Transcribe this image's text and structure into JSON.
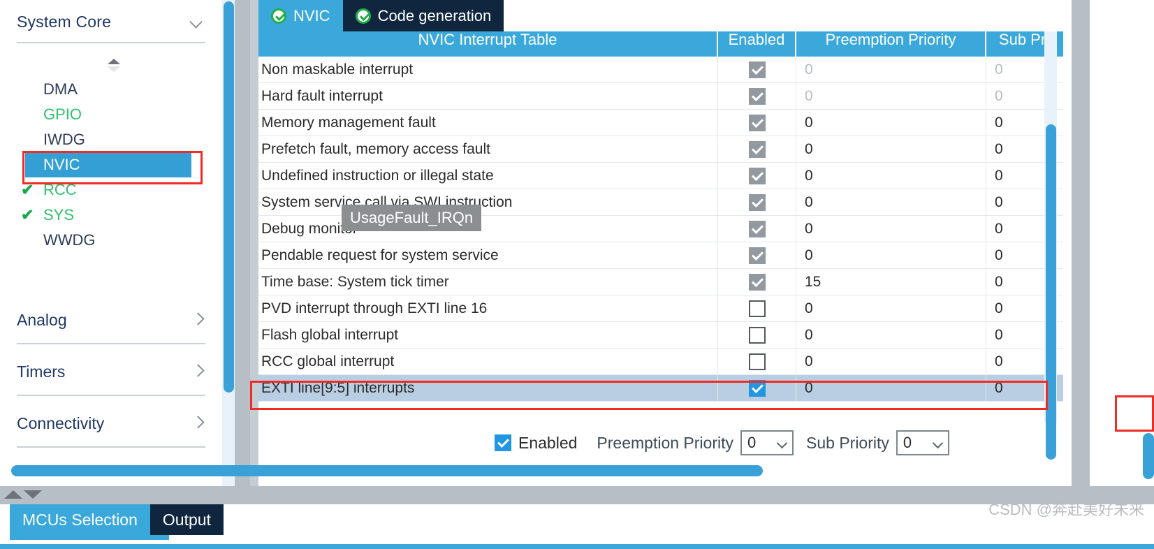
{
  "sidebar": {
    "header": {
      "title": "System Core",
      "chevron": "chevron-down-icon"
    },
    "sorter_icon": "sort-updown-icon",
    "items": [
      {
        "label": "DMA",
        "state": "normal",
        "check": ""
      },
      {
        "label": "GPIO",
        "state": "configured",
        "check": ""
      },
      {
        "label": "IWDG",
        "state": "normal",
        "check": ""
      },
      {
        "label": "NVIC",
        "state": "selected",
        "check": ""
      },
      {
        "label": "RCC",
        "state": "configured",
        "check": "✔"
      },
      {
        "label": "SYS",
        "state": "configured",
        "check": "✔"
      },
      {
        "label": "WWDG",
        "state": "normal",
        "check": ""
      }
    ],
    "groups": [
      {
        "label": "Analog",
        "chevron": "chevron-right-icon"
      },
      {
        "label": "Timers",
        "chevron": "chevron-right-icon"
      },
      {
        "label": "Connectivity",
        "chevron": "chevron-right-icon"
      }
    ]
  },
  "main": {
    "tabs": [
      {
        "label": "NVIC",
        "active": true,
        "icon": "check-circle-icon"
      },
      {
        "label": "Code generation",
        "active": false,
        "icon": "check-circle-icon"
      }
    ],
    "table": {
      "headers": {
        "name": "NVIC Interrupt Table",
        "enabled": "Enabled",
        "preemption": "Preemption Priority",
        "sub": "Sub Pri"
      },
      "rows": [
        {
          "name": "Non maskable interrupt",
          "enabled": "checked-disabled",
          "pre": "0",
          "sub": "0",
          "dim": true,
          "selected": false
        },
        {
          "name": "Hard fault interrupt",
          "enabled": "checked-disabled",
          "pre": "0",
          "sub": "0",
          "dim": true,
          "selected": false
        },
        {
          "name": "Memory management fault",
          "enabled": "checked-disabled",
          "pre": "0",
          "sub": "0",
          "dim": false,
          "selected": false
        },
        {
          "name": "Prefetch fault, memory access fault",
          "enabled": "checked-disabled",
          "pre": "0",
          "sub": "0",
          "dim": false,
          "selected": false
        },
        {
          "name": "Undefined instruction or illegal state",
          "enabled": "checked-disabled",
          "pre": "0",
          "sub": "0",
          "dim": false,
          "selected": false
        },
        {
          "name": "System service call via SWI instruction",
          "enabled": "checked-disabled",
          "pre": "0",
          "sub": "0",
          "dim": false,
          "selected": false
        },
        {
          "name": "Debug monitor",
          "enabled": "checked-disabled",
          "pre": "0",
          "sub": "0",
          "dim": false,
          "selected": false
        },
        {
          "name": "Pendable request for system service",
          "enabled": "checked-disabled",
          "pre": "0",
          "sub": "0",
          "dim": false,
          "selected": false
        },
        {
          "name": "Time base: System tick timer",
          "enabled": "checked-disabled",
          "pre": "15",
          "sub": "0",
          "dim": false,
          "selected": false
        },
        {
          "name": "PVD interrupt through EXTI line 16",
          "enabled": "unchecked",
          "pre": "0",
          "sub": "0",
          "dim": false,
          "selected": false
        },
        {
          "name": "Flash global interrupt",
          "enabled": "unchecked",
          "pre": "0",
          "sub": "0",
          "dim": false,
          "selected": false
        },
        {
          "name": "RCC global interrupt",
          "enabled": "unchecked",
          "pre": "0",
          "sub": "0",
          "dim": false,
          "selected": false
        },
        {
          "name": "EXTI line[9:5] interrupts",
          "enabled": "checked-on",
          "pre": "0",
          "sub": "0",
          "dim": false,
          "selected": true
        }
      ]
    },
    "tooltip": {
      "text": "UsageFault_IRQn"
    },
    "controls": {
      "enabled_label": "Enabled",
      "enabled_checked": true,
      "preemption_label": "Preemption Priority",
      "preemption_value": "0",
      "sub_label": "Sub Priority",
      "sub_value": "0",
      "dropdown_icon": "chevron-down-icon"
    }
  },
  "bottom": {
    "splitter": {
      "up_icon": "triangle-up-icon",
      "down_icon": "triangle-down-icon"
    },
    "tabs": [
      {
        "label": "MCUs Selection",
        "active": true
      },
      {
        "label": "Output",
        "active": false
      }
    ],
    "watermark": "CSDN @奔赴美好未来"
  },
  "colors": {
    "accent": "#3aa8db",
    "tab_inactive": "#10263f",
    "highlight_red": "#ef2b23",
    "row_selected": "#b9cee2",
    "sidebar_text": "#1f3864",
    "green_check": "#2fbf6b"
  }
}
